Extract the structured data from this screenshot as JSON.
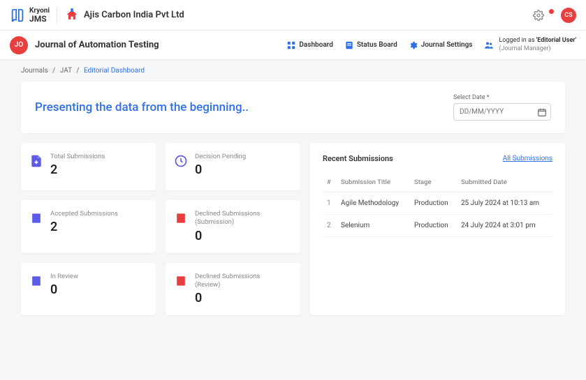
{
  "topbar": {
    "logo_line1": "Kryoni",
    "logo_line2": "JMS",
    "org_name": "Ajis Carbon India Pvt Ltd",
    "avatar_initials": "CS"
  },
  "subbar": {
    "journal_badge": "JO",
    "journal_title": "Journal of Automation Testing",
    "nav": {
      "dashboard": "Dashboard",
      "status_board": "Status Board",
      "journal_settings": "Journal Settings"
    },
    "logged_in_prefix": "Logged in as ",
    "logged_in_user": "'Editorial User'",
    "logged_in_role": "(Journal Manager)"
  },
  "breadcrumb": {
    "l1": "Journals",
    "l2": "JAT",
    "l3": "Editorial Dashboard"
  },
  "banner": {
    "text": "Presenting the data from the beginning..",
    "date_label": "Select Date *",
    "date_placeholder": "DD/MM/YYYY"
  },
  "stats": {
    "total": {
      "label": "Total Submissions",
      "value": "2"
    },
    "pending": {
      "label": "Decision Pending",
      "value": "0"
    },
    "accepted": {
      "label": "Accepted Submissions",
      "value": "2"
    },
    "declined_sub": {
      "label": "Declined Submissions",
      "sub": "(Submission)",
      "value": "0"
    },
    "in_review": {
      "label": "In Review",
      "value": "0"
    },
    "declined_rev": {
      "label": "Declined Submissions",
      "sub": "(Review)",
      "value": "0"
    }
  },
  "recent": {
    "title": "Recent Submissions",
    "link": "All Submissions",
    "cols": {
      "idx": "#",
      "title": "Submission Title",
      "stage": "Stage",
      "date": "Submitted Date"
    },
    "rows": [
      {
        "idx": "1",
        "title": "Agile Methodology",
        "stage": "Production",
        "date": "25 July 2024 at 10:13 am"
      },
      {
        "idx": "2",
        "title": "Selenium",
        "stage": "Production",
        "date": "24 July 2024 at 3:01 pm"
      }
    ]
  }
}
